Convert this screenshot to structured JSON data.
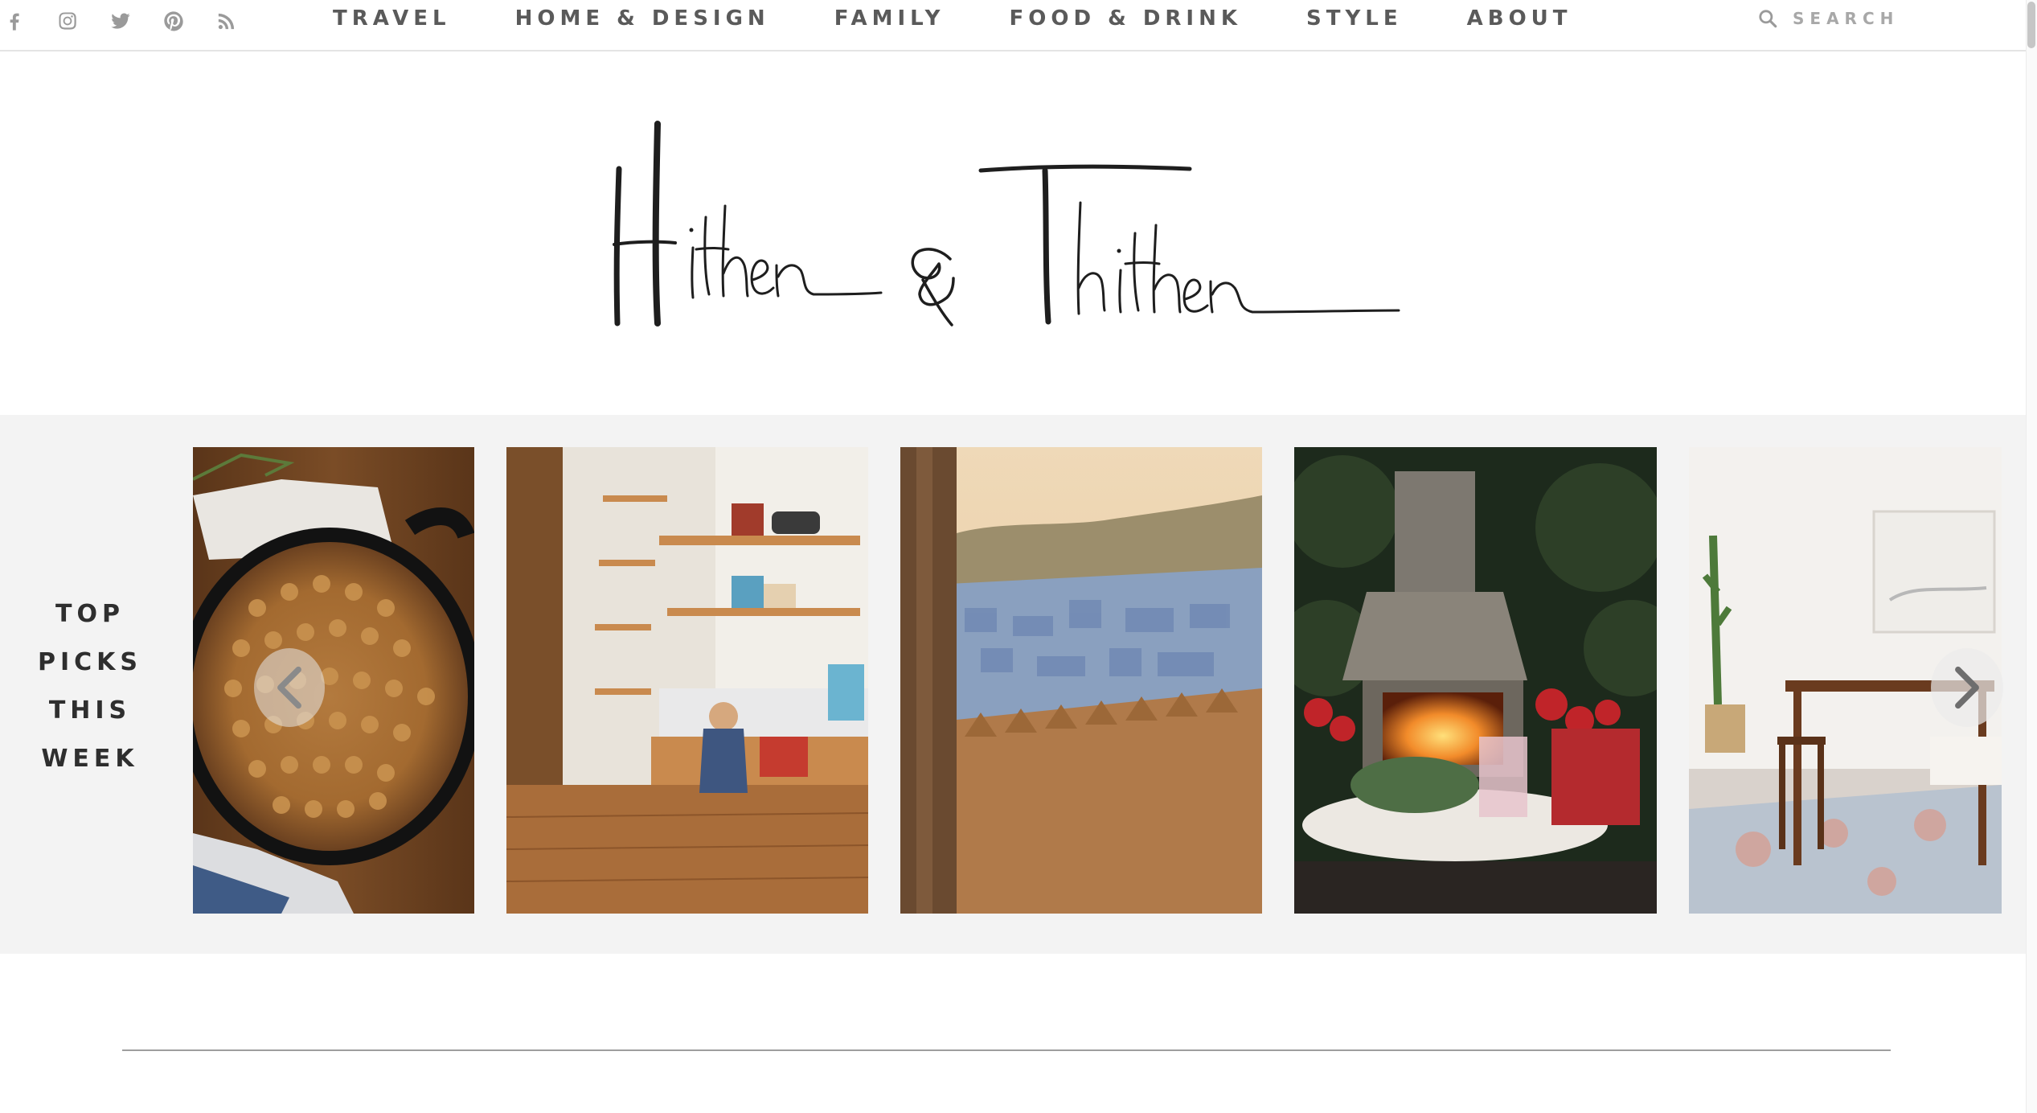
{
  "social": {
    "icons": [
      "facebook-icon",
      "instagram-icon",
      "twitter-icon",
      "pinterest-icon",
      "rss-icon"
    ]
  },
  "nav": {
    "items": [
      {
        "label": "TRAVEL"
      },
      {
        "label": "HOME & DESIGN"
      },
      {
        "label": "FAMILY"
      },
      {
        "label": "FOOD & DRINK"
      },
      {
        "label": "STYLE"
      },
      {
        "label": "ABOUT"
      }
    ]
  },
  "search": {
    "placeholder": "SEARCH"
  },
  "logo": {
    "text": "Hither & Thither"
  },
  "carousel": {
    "heading": [
      "TOP",
      "PICKS",
      "THIS",
      "WEEK"
    ],
    "cards": [
      {
        "subject": "chickpea skillet"
      },
      {
        "subject": "child's bedroom with shelves"
      },
      {
        "subject": "blue city at sunset"
      },
      {
        "subject": "outdoor fireplace"
      },
      {
        "subject": "mid-century dining room"
      }
    ]
  },
  "colors": {
    "band_background": "#f3f3f3",
    "nav_text": "#5a5a5a",
    "icon_gray": "#9a9a9a"
  }
}
